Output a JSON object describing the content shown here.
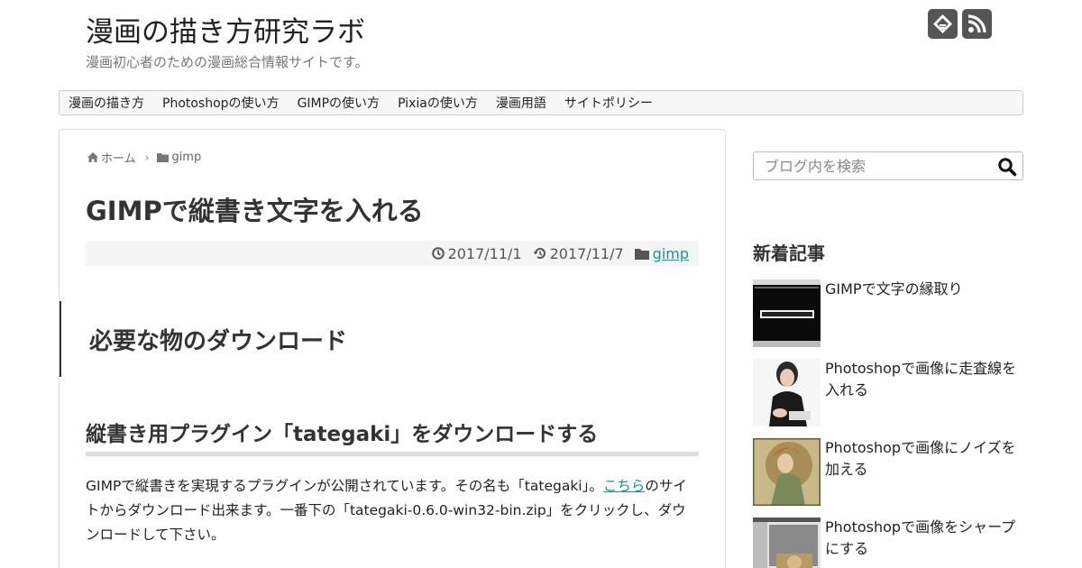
{
  "header": {
    "site_title": "漫画の描き方研究ラボ",
    "site_description": "漫画初心者のための漫画総合情報サイトです。"
  },
  "nav": {
    "items": [
      {
        "label": "漫画の描き方"
      },
      {
        "label": "Photoshopの使い方"
      },
      {
        "label": "GIMPの使い方"
      },
      {
        "label": "Pixiaの使い方"
      },
      {
        "label": "漫画用語"
      },
      {
        "label": "サイトポリシー"
      }
    ]
  },
  "breadcrumb": {
    "home": "ホーム",
    "category": "gimp"
  },
  "post": {
    "title": "GIMPで縦書き文字を入れる",
    "published": "2017/11/1",
    "updated": "2017/11/7",
    "category": "gimp",
    "h2": "必要な物のダウンロード",
    "h3": "縦書き用プラグイン「tategaki」をダウンロードする",
    "para1_before": "GIMPで縦書きを実現するプラグインが公開されています。その名も「tategaki」。",
    "para1_link": "こちら",
    "para1_after": "のサイトからダウンロード出来ます。一番下の「tategaki-0.6.0-win32-bin.zip」をクリックし、ダウンロードして下さい。"
  },
  "sidebar": {
    "search_placeholder": "ブログ内を検索",
    "recent_heading": "新着記事",
    "recent": [
      {
        "title": "GIMPで文字の縁取り"
      },
      {
        "title": "Photoshopで画像に走査線を入れる"
      },
      {
        "title": "Photoshopで画像にノイズを加える"
      },
      {
        "title": "Photoshopで画像をシャープにする"
      }
    ]
  },
  "icons": {
    "social": [
      "feedly-icon",
      "rss-icon"
    ],
    "breadcrumb": [
      "home-icon",
      "folder-icon"
    ],
    "meta": [
      "clock-icon",
      "history-icon",
      "folder-icon"
    ],
    "search": "search-icon"
  },
  "colors": {
    "link": "#1a8fa8",
    "social_bg": "#555555",
    "meta_bg": "#f5f5f5"
  }
}
